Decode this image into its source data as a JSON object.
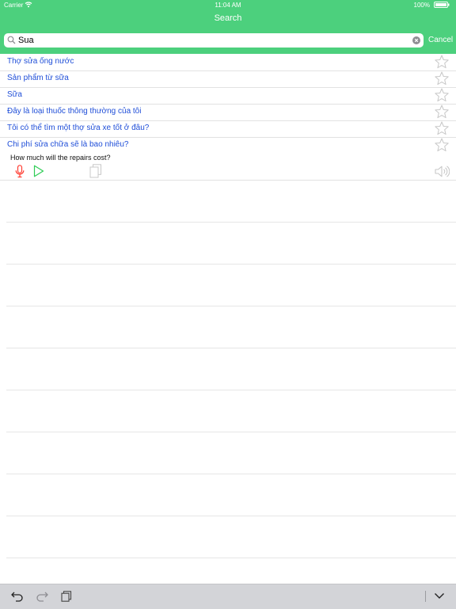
{
  "status_bar": {
    "carrier": "Carrier",
    "time": "11:04 AM",
    "battery": "100%"
  },
  "nav": {
    "title": "Search"
  },
  "search": {
    "value": "Sua",
    "placeholder": "",
    "cancel_label": "Cancel"
  },
  "results": [
    "Thợ sửa ống nước",
    "Sản phẩm từ sữa",
    "Sữa",
    "Đây là loại thuốc thông thường của tôi",
    "Tôi có thể tìm một thợ sửa xe tốt ở đâu?",
    "Chi phí sửa chữa sẽ là bao nhiêu?"
  ],
  "expanded": {
    "translation": "How much will the repairs cost?"
  },
  "icons": {
    "result_star": "star-outline-icon",
    "record": "microphone-icon",
    "play": "play-icon",
    "copy": "copy-icon",
    "speaker": "speaker-icon",
    "keyboard_undo": "undo-icon",
    "keyboard_redo": "redo-icon",
    "keyboard_paste": "clipboard-icon",
    "keyboard_dismiss": "chevron-down-icon"
  },
  "colors": {
    "header": "#4cd07d",
    "phrase_text": "#1f4ed8",
    "mic": "#ff3b30",
    "play": "#2ecc55",
    "star": "#c8c8c8"
  }
}
